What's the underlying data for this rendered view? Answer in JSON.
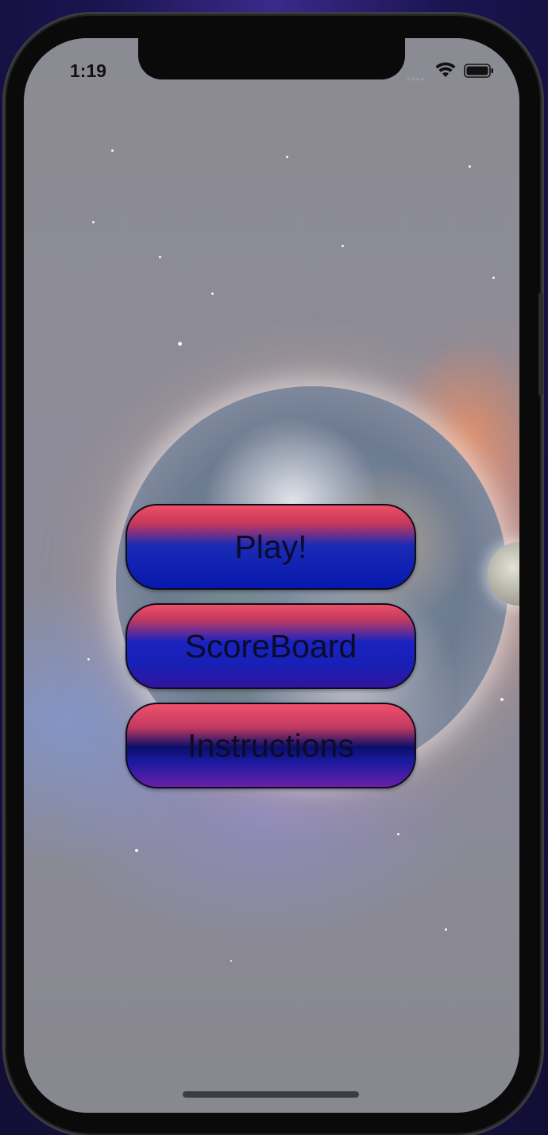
{
  "status_bar": {
    "time": "1:19",
    "signal_icon": "signal-dots-icon",
    "wifi_icon": "wifi-icon",
    "battery_icon": "battery-icon"
  },
  "menu": {
    "play_label": "Play!",
    "scoreboard_label": "ScoreBoard",
    "instructions_label": "Instructions"
  },
  "colors": {
    "button_top": "#ef4f66",
    "button_bottom": "#0718ae",
    "button_text": "#0b0b2a"
  }
}
